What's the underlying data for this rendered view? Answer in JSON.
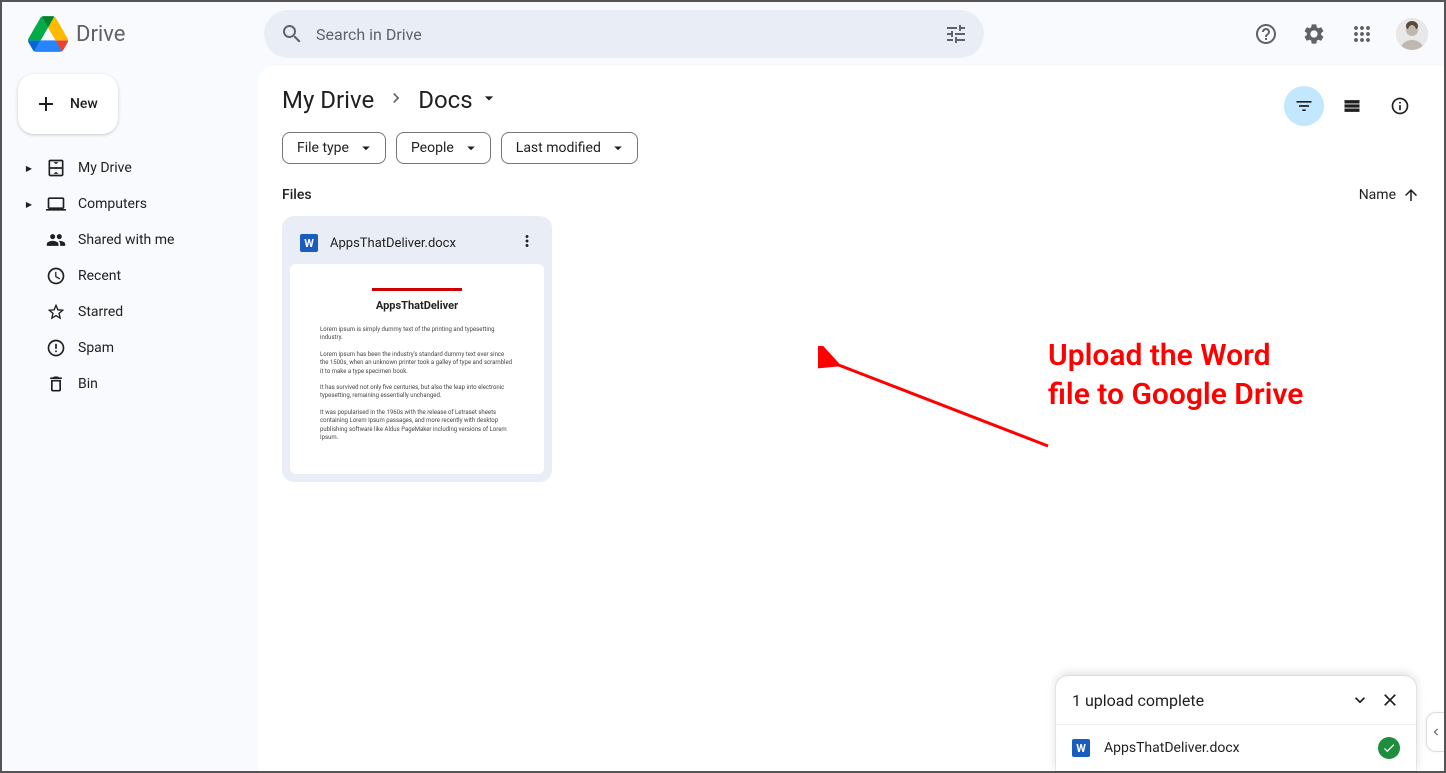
{
  "header": {
    "product": "Drive",
    "search_placeholder": "Search in Drive"
  },
  "sidebar": {
    "new_label": "New",
    "items": [
      {
        "label": "My Drive",
        "expandable": true
      },
      {
        "label": "Computers",
        "expandable": true
      },
      {
        "label": "Shared with me",
        "expandable": false
      },
      {
        "label": "Recent",
        "expandable": false
      },
      {
        "label": "Starred",
        "expandable": false
      },
      {
        "label": "Spam",
        "expandable": false
      },
      {
        "label": "Bin",
        "expandable": false
      }
    ]
  },
  "breadcrumb": {
    "root": "My Drive",
    "current": "Docs"
  },
  "filters": {
    "file_type": "File type",
    "people": "People",
    "modified": "Last modified"
  },
  "section": {
    "title": "Files",
    "sort_label": "Name"
  },
  "files": [
    {
      "name": "AppsThatDeliver.docx",
      "thumb_title": "AppsThatDeliver"
    }
  ],
  "annotation": {
    "line1": "Upload the Word",
    "line2": "file to Google Drive"
  },
  "upload_toast": {
    "title": "1 upload complete",
    "items": [
      {
        "name": "AppsThatDeliver.docx"
      }
    ]
  }
}
